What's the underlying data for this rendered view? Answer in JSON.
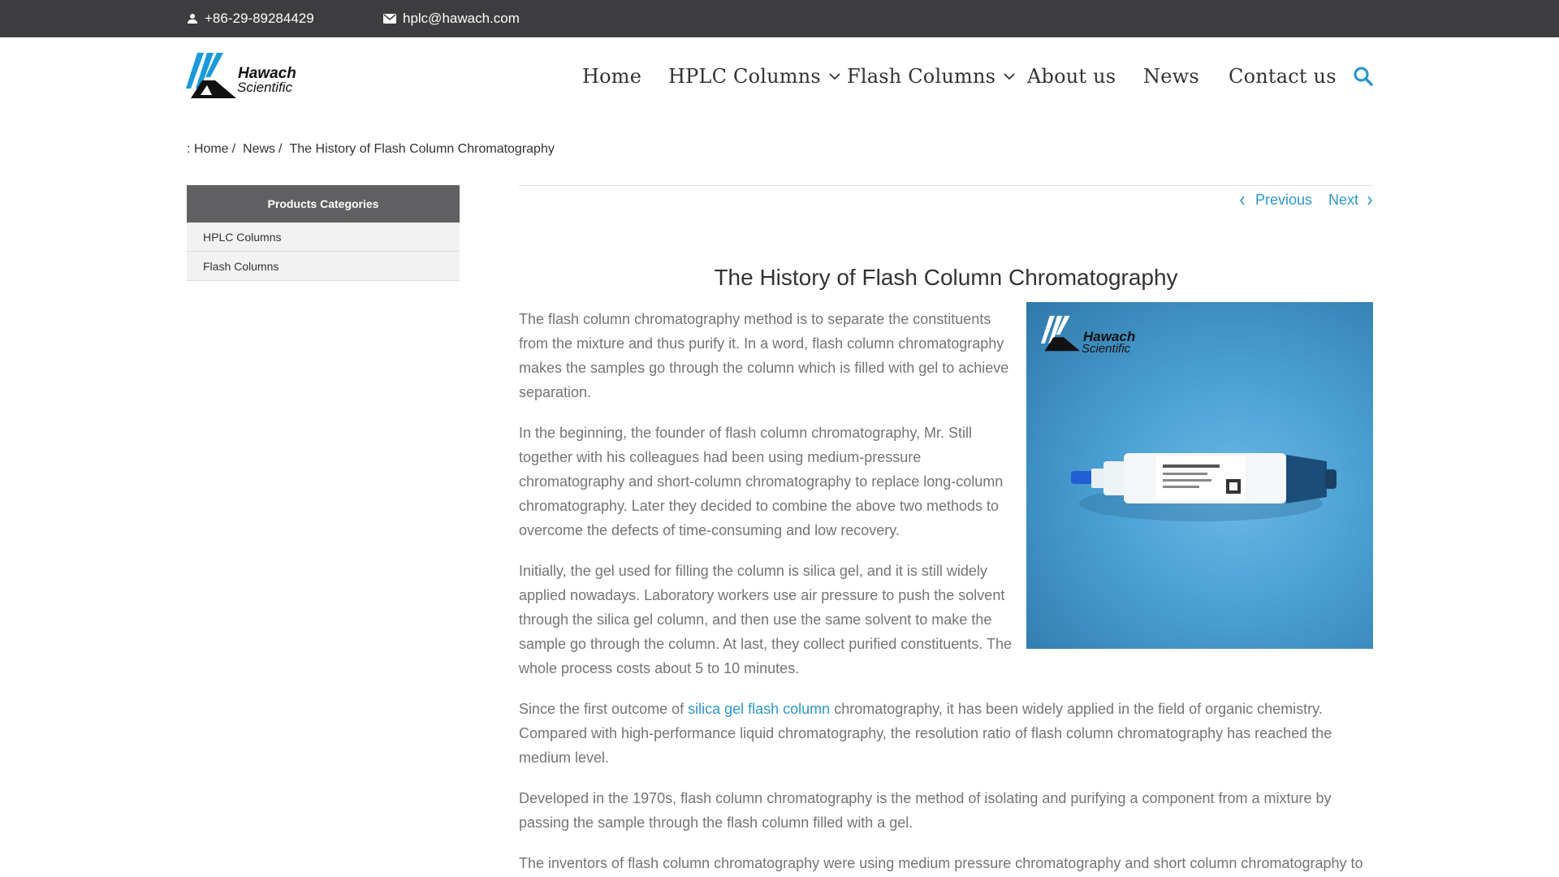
{
  "topbar": {
    "phone": "+86-29-89284429",
    "email": "hplc@hawach.com"
  },
  "logo": {
    "line1": "Hawach",
    "line2": "Scientific"
  },
  "nav": {
    "items": [
      {
        "label": "Home"
      },
      {
        "label": "HPLC Columns"
      },
      {
        "label": "Flash Columns"
      },
      {
        "label": "About us"
      },
      {
        "label": "News"
      },
      {
        "label": "Contact us"
      }
    ]
  },
  "breadcrumb": {
    "prefix": ": Home",
    "sep": "/",
    "news": "News",
    "current": "The History of Flash Column Chromatography"
  },
  "sidebar": {
    "heading": "Products Categories",
    "items": [
      {
        "label": "HPLC Columns"
      },
      {
        "label": "Flash Columns"
      }
    ]
  },
  "pager": {
    "previous": "Previous",
    "next": "Next"
  },
  "post": {
    "title": "The History of Flash Column Chromatography",
    "image_logo_line1": "Hawach",
    "image_logo_line2": "Scientific",
    "paragraphs": [
      "The flash column chromatography method is to separate the constituents from the mixture and thus purify it. In a word, flash column chromatography makes the samples go through the column which is filled with gel to achieve separation.",
      "In the beginning, the founder of flash column chromatography, Mr. Still together with his colleagues had been using medium-pressure chromatography and short-column chromatography to replace long-column chromatography. Later they decided to combine the above two methods to overcome the defects of time-consuming and low recovery.",
      "Initially, the gel used for filling the column is silica gel, and it is still widely applied nowadays. Laboratory workers use air pressure to push the solvent through the silica gel column, and then use the same solvent to make the sample go through the column. At last, they collect purified constituents. The whole process costs about 5 to 10 minutes."
    ],
    "p4_before": "Since the first outcome of ",
    "p4_link": "silica gel flash column",
    "p4_after": " chromatography, it has been widely applied in the field of organic chemistry. Compared with high-performance liquid chromatography, the resolution ratio of flash column chromatography has reached the medium level.",
    "p5": "Developed in the 1970s, flash column chromatography is the method of isolating and purifying a component from a mixture by passing the sample through the flash column filled with a gel.",
    "p6": "The inventors of flash column chromatography were using medium pressure chromatography and short column chromatography to"
  },
  "colors": {
    "topbar": "#3d3d3f",
    "accent": "#2d97c9",
    "logo_blue": "#1a9ad9",
    "sidebar_head": "#606062"
  },
  "icons": {
    "phone": "person-icon",
    "email": "envelope-icon",
    "search": "search-icon",
    "dropdown": "chevron-down-icon",
    "prev": "chevron-left-icon",
    "next": "chevron-right-icon"
  }
}
